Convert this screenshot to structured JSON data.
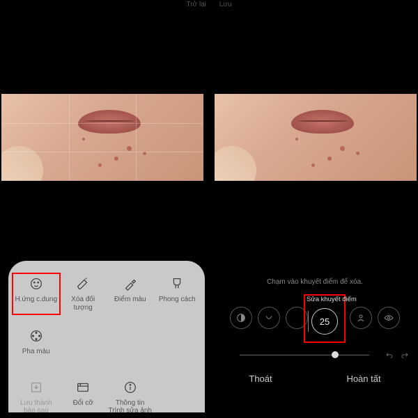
{
  "header": {
    "back": "Trở lại",
    "save": "Lưu"
  },
  "leftPanel": {
    "tools": [
      {
        "label": "H.ứng c.dung"
      },
      {
        "label": "Xóa đối tượng"
      },
      {
        "label": "Điểm màu"
      },
      {
        "label": "Phong cách"
      },
      {
        "label": "Pha màu"
      }
    ],
    "meta": [
      {
        "label": "Lưu thành bản sao"
      },
      {
        "label": "Đổi cỡ"
      },
      {
        "label": "Thông tin Trình sửa ảnh"
      }
    ]
  },
  "rightPanel": {
    "hint": "Chạm vào khuyết điểm để xóa.",
    "brushLabel": "Sửa khuyết điểm",
    "brushSize": "25",
    "exit": "Thoát",
    "done": "Hoàn tất"
  }
}
